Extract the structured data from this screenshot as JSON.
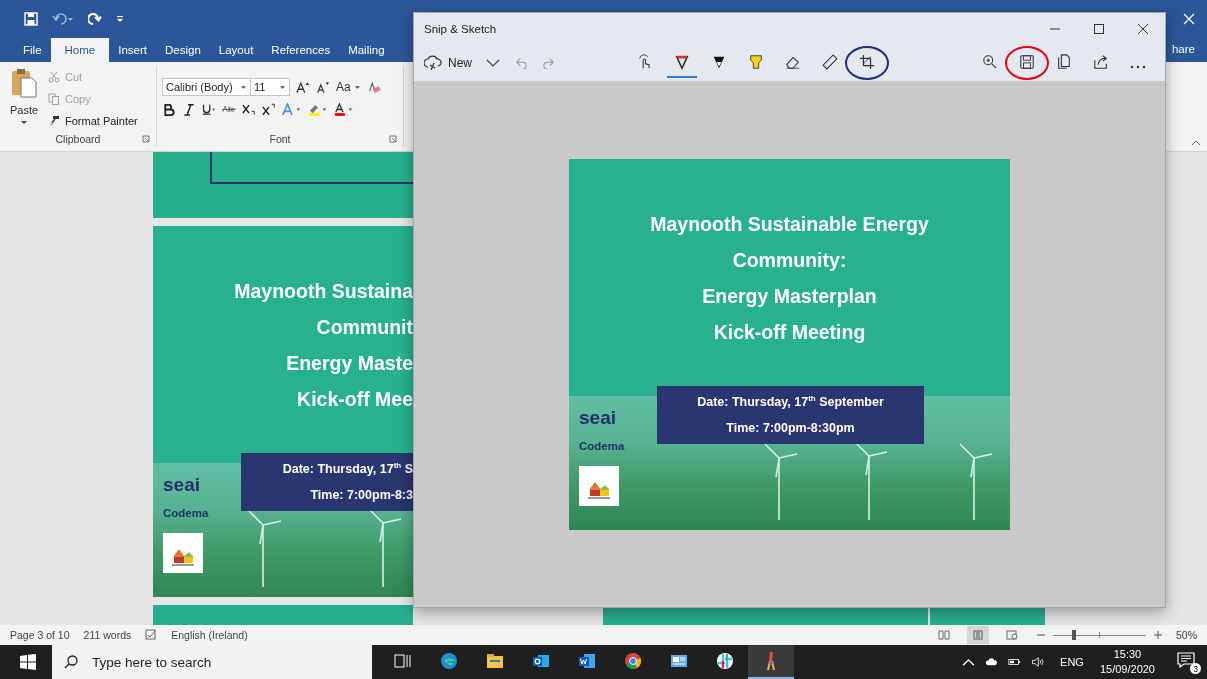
{
  "word": {
    "tabs": [
      {
        "label": "File",
        "selected": false
      },
      {
        "label": "Home",
        "selected": true
      },
      {
        "label": "Insert",
        "selected": false
      },
      {
        "label": "Design",
        "selected": false
      },
      {
        "label": "Layout",
        "selected": false
      },
      {
        "label": "References",
        "selected": false
      },
      {
        "label": "Mailing",
        "selected": false
      }
    ],
    "share_label": "hare",
    "clipboard": {
      "paste": "Paste",
      "items": [
        {
          "kind": "cut",
          "label": "Cut",
          "disabled": true
        },
        {
          "kind": "copy",
          "label": "Copy",
          "disabled": true
        },
        {
          "kind": "painter",
          "label": "Format Painter",
          "disabled": false
        }
      ],
      "label": "Clipboard"
    },
    "font": {
      "font_name": "Calibri (Body)",
      "font_size": "11",
      "change_case": "Aa",
      "label": "Font"
    },
    "poster": {
      "title_lines": [
        "Maynooth Sustaina",
        "Communit",
        "Energy Maste",
        "Kick-off Mee"
      ],
      "date": "Date: Thursday, 17$^{th}$ S",
      "time": "Time: 7:00pm-8:3",
      "logos": [
        "seai",
        "Codema"
      ]
    },
    "status_bar": {
      "page": "Page 3 of 10",
      "words": "211 words",
      "language": "English (Ireland)",
      "views": [
        {
          "kind": "read",
          "selected": false
        },
        {
          "kind": "print",
          "selected": true
        },
        {
          "kind": "web",
          "selected": false
        }
      ],
      "zoom": {
        "level": 0.23,
        "label": "50%"
      }
    }
  },
  "snip": {
    "title": "Snip & Sketch",
    "new_label": "New",
    "tools": [
      {
        "kind": "touch",
        "selected": false
      },
      {
        "kind": "ballpoint",
        "selected": true
      },
      {
        "kind": "pencil",
        "selected": false
      },
      {
        "kind": "highlighter",
        "selected": false
      },
      {
        "kind": "eraser",
        "selected": false
      },
      {
        "kind": "ruler",
        "selected": false
      },
      {
        "kind": "crop",
        "selected": false,
        "color": "#1f2f7a"
      }
    ],
    "actions": [
      {
        "kind": "zoom"
      },
      {
        "kind": "save",
        "color": "#e30613"
      },
      {
        "kind": "copy"
      },
      {
        "kind": "share"
      },
      {
        "kind": "more"
      }
    ],
    "image": {
      "title_lines": [
        "Maynooth Sustainable Energy",
        "Community:",
        "Energy Masterplan",
        "Kick-off Meeting"
      ],
      "date": "Date: Thursday, 17$^{th}$ September",
      "time": "Time: 7:00pm-8:30pm",
      "logos": [
        "seai",
        "Codema"
      ]
    }
  },
  "taskbar": {
    "search_placeholder": "Type here to search",
    "apps": [
      {
        "kind": "taskview",
        "selected": false
      },
      {
        "kind": "edge",
        "selected": false
      },
      {
        "kind": "explorer",
        "selected": false
      },
      {
        "kind": "outlook",
        "selected": false
      },
      {
        "kind": "word",
        "selected": false
      },
      {
        "kind": "chrome",
        "selected": false
      },
      {
        "kind": "mail",
        "selected": false
      },
      {
        "kind": "slack",
        "selected": false
      },
      {
        "kind": "snip",
        "selected": true
      }
    ],
    "language": "ENG",
    "time": "15:30",
    "date": "15/09/2020",
    "notification_count": "3"
  }
}
